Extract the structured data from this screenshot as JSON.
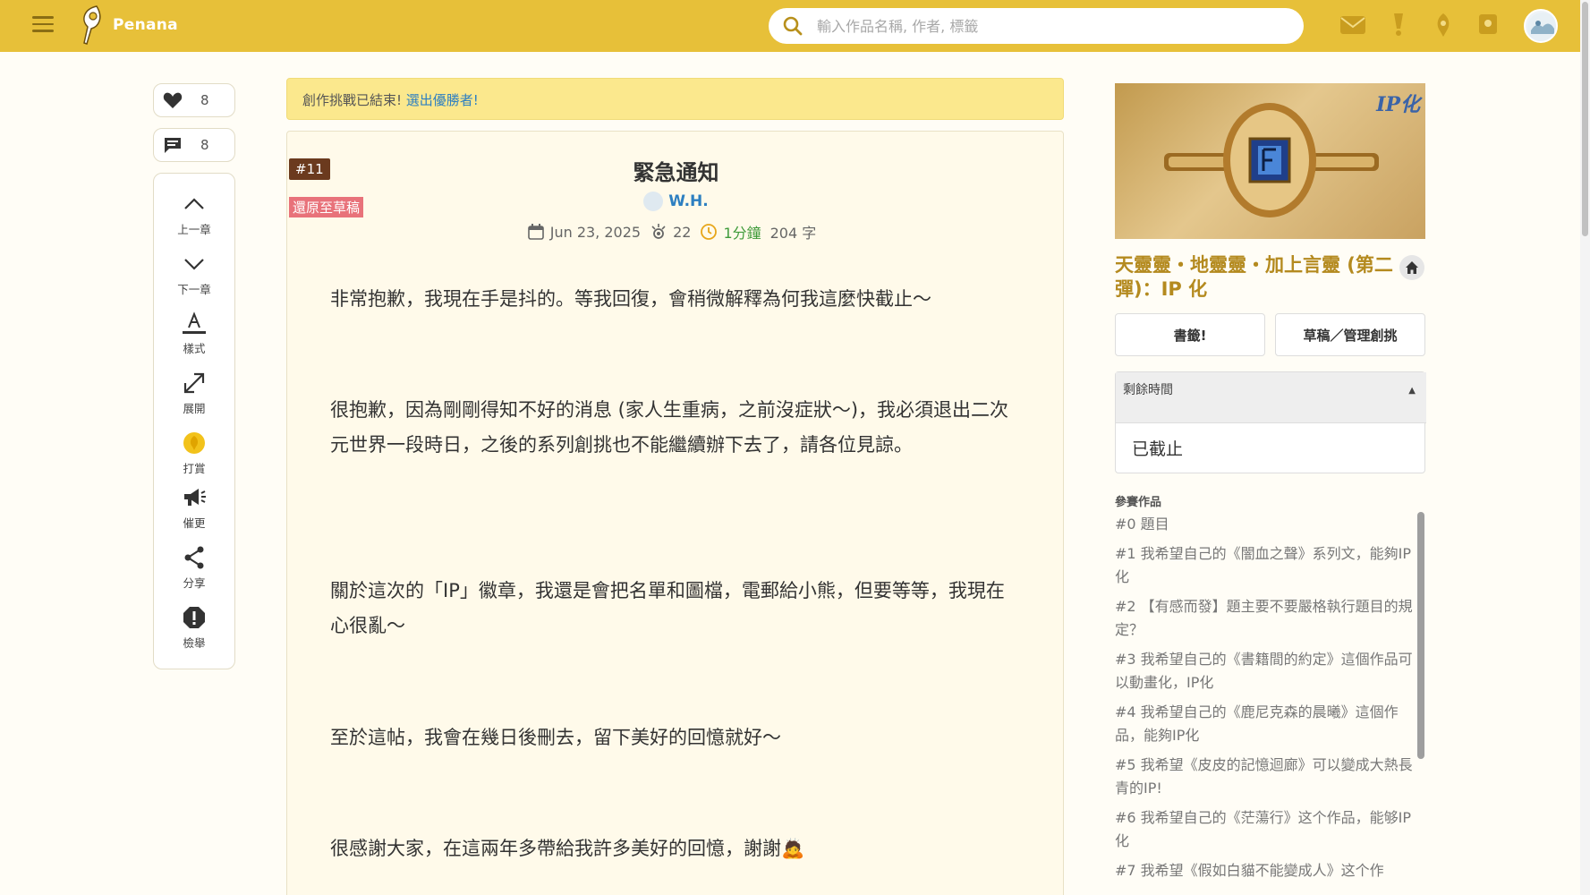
{
  "header": {
    "logo_text": "Penana",
    "search_placeholder": "輸入作品名稱, 作者, 標籤"
  },
  "actions": {
    "likes": "8",
    "comments": "8",
    "rail": [
      {
        "label": "上一章",
        "icon": "chevron-up-icon"
      },
      {
        "label": "下一章",
        "icon": "chevron-down-icon"
      },
      {
        "label": "樣式",
        "icon": "text-style-icon"
      },
      {
        "label": "展開",
        "icon": "expand-icon"
      },
      {
        "label": "打賞",
        "icon": "tip-icon"
      },
      {
        "label": "催更",
        "icon": "megaphone-icon"
      },
      {
        "label": "分享",
        "icon": "share-icon"
      },
      {
        "label": "檢舉",
        "icon": "report-icon"
      }
    ]
  },
  "notice": {
    "text": "創作挑戰已結束!",
    "link": "選出優勝者!"
  },
  "article": {
    "chapter_no": "#11",
    "revert_label": "還原至草稿",
    "title": "緊急通知",
    "author": "W.H.",
    "date": "Jun 23, 2025",
    "views": "22",
    "read_time": "1分鐘",
    "word_count": "204 字",
    "paragraphs": [
      "非常抱歉，我現在手是抖的。等我回復，會稍微解釋為何我這麼快截止～",
      "很抱歉，因為剛剛得知不好的消息 (家人生重病，之前沒症狀～)，我必須退出二次元世界一段時日，之後的系列創挑也不能繼續辦下去了，請各位見諒。",
      "關於這次的「IP」徽章，我還是會把名單和圖檔，電郵給小熊，但要等等，我現在心很亂～",
      "至於這帖，我會在幾日後刪去，留下美好的回憶就好～",
      "很感謝大家，在這兩年多帶給我許多美好的回憶，謝謝🙇"
    ]
  },
  "sidebar": {
    "cover_tag": "IP化",
    "title": "天靈靈・地靈靈・加上言靈 (第二彈)：IP 化",
    "bookmark_button": "書籤!",
    "manage_button": "草稿／管理創挑",
    "time_label": "剩餘時間",
    "time_value": "已截止",
    "entries_label": "參賽作品",
    "entries": [
      "#0 題目",
      "#1 我希望自己的《闇血之聲》系列文，能夠IP 化",
      "#2 【有感而發】題主要不要嚴格執行題目的規定？",
      "#3 我希望自己的《書籍間的約定》這個作品可以動畫化，IP化",
      "#4 我希望自己的《鹿尼克森的晨曦》這個作品，能夠IP化",
      "#5 我希望《皮皮的記憶迴廊》可以變成大熱長青的IP!",
      "#6 我希望自己的《茫蕩行》这个作品，能够IP化",
      "#7 我希望《假如白貓不能變成人》这个作"
    ]
  },
  "colors": {
    "topbar": "#e7c039",
    "accent_link": "#2d7fc1",
    "title_gold": "#b48a1f",
    "revert_red": "#e8727a"
  }
}
